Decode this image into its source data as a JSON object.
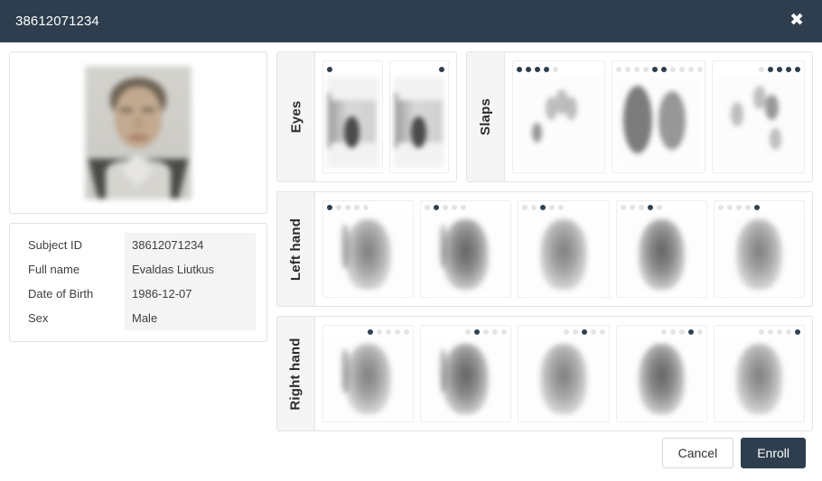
{
  "header": {
    "title": "38612071234",
    "close_icon": "close-icon",
    "close_glyph": "✖",
    "background_color": "#2e3e4e"
  },
  "subject": {
    "photo_alt": "subject-portrait",
    "details": [
      {
        "label": "Subject ID",
        "value": "38612071234"
      },
      {
        "label": "Full name",
        "value": "Evaldas Liutkus"
      },
      {
        "label": "Date of Birth",
        "value": "1986-12-07"
      },
      {
        "label": "Sex",
        "value": "Male"
      }
    ]
  },
  "biometrics": {
    "dot_on_color": "#2e3e4e",
    "dot_off_color": "#e2e4e6",
    "panels": [
      {
        "label": "Eyes",
        "cells": [
          {
            "type": "eye",
            "dots_total": 1,
            "dots_on": [
              1
            ],
            "align": "left"
          },
          {
            "type": "eye",
            "dots_total": 1,
            "dots_on": [
              1
            ],
            "align": "right"
          }
        ]
      },
      {
        "label": "Slaps",
        "cells": [
          {
            "type": "slap",
            "dots_total": 5,
            "dots_on": [
              1,
              2,
              3,
              4
            ],
            "align": "left"
          },
          {
            "type": "slap",
            "dots_total": 10,
            "dots_on": [
              5,
              6
            ],
            "align": "spread"
          },
          {
            "type": "slap",
            "dots_total": 5,
            "dots_on": [
              2,
              3,
              4,
              5
            ],
            "align": "right"
          }
        ]
      },
      {
        "label": "Left hand",
        "cells": [
          {
            "type": "finger",
            "dots_total": 5,
            "dots_on": [
              1
            ],
            "align": "left"
          },
          {
            "type": "finger",
            "dots_total": 5,
            "dots_on": [
              2
            ],
            "align": "left"
          },
          {
            "type": "finger",
            "dots_total": 5,
            "dots_on": [
              3
            ],
            "align": "left"
          },
          {
            "type": "finger",
            "dots_total": 5,
            "dots_on": [
              4
            ],
            "align": "left"
          },
          {
            "type": "finger",
            "dots_total": 5,
            "dots_on": [
              5
            ],
            "align": "left"
          }
        ]
      },
      {
        "label": "Right hand",
        "cells": [
          {
            "type": "finger",
            "dots_total": 5,
            "dots_on": [
              1
            ],
            "align": "right"
          },
          {
            "type": "finger",
            "dots_total": 5,
            "dots_on": [
              2
            ],
            "align": "right"
          },
          {
            "type": "finger",
            "dots_total": 5,
            "dots_on": [
              3
            ],
            "align": "right"
          },
          {
            "type": "finger",
            "dots_total": 5,
            "dots_on": [
              4
            ],
            "align": "right"
          },
          {
            "type": "finger",
            "dots_total": 5,
            "dots_on": [
              5
            ],
            "align": "right"
          }
        ]
      }
    ]
  },
  "footer": {
    "cancel_label": "Cancel",
    "enroll_label": "Enroll",
    "enroll_color": "#2e3e4e"
  }
}
